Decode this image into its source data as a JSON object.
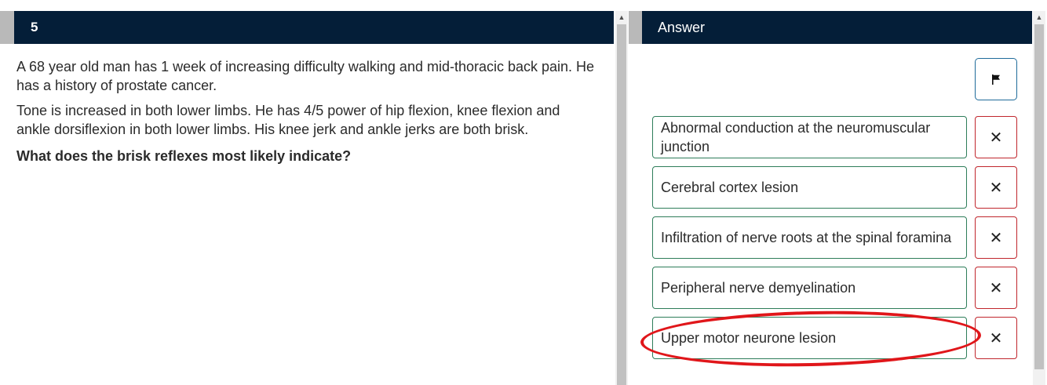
{
  "question": {
    "number": "5",
    "stem_1": "A 68 year old man has 1 week of increasing difficulty walking and mid-thoracic back pain. He has a history of prostate cancer.",
    "stem_2": "Tone is increased in both lower limbs. He has 4/5 power of hip flexion, knee flexion and ankle dorsiflexion in both lower limbs. His knee jerk and ankle jerks are both brisk.",
    "prompt": "What does the brisk reflexes most likely indicate?"
  },
  "answer": {
    "header": "Answer",
    "flag_icon": "flag-icon",
    "strike_glyph": "✕",
    "options": [
      {
        "label": "Abnormal conduction at the neuromuscular junction"
      },
      {
        "label": "Cerebral cortex lesion"
      },
      {
        "label": "Infiltration of nerve roots at the spinal foramina"
      },
      {
        "label": "Peripheral nerve demyelination"
      },
      {
        "label": "Upper motor neurone lesion"
      }
    ]
  },
  "colors": {
    "header_bg": "#041e38",
    "option_border": "#2e7d5a",
    "strike_border": "#c0262d",
    "flag_border": "#1f6b9a",
    "annotation_circle": "#e0161a"
  }
}
